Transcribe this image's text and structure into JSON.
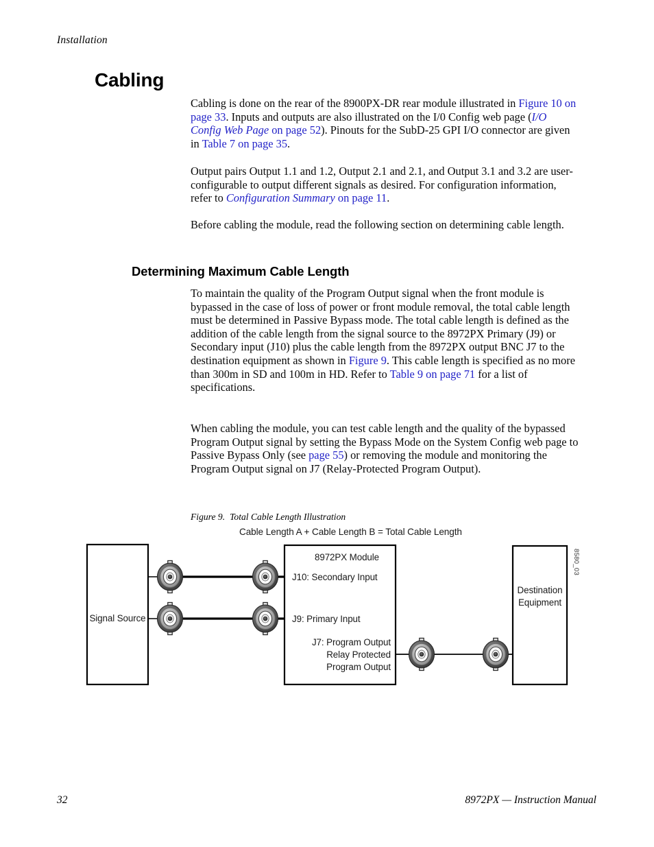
{
  "running_head": "Installation",
  "headings": {
    "h1": "Cabling",
    "h2": "Determining Maximum Cable Length"
  },
  "paragraphs": {
    "p1": {
      "seg1": "Cabling is done on the rear of the 8900PX-DR rear module illustrated in ",
      "link1": "Figure 10 on page 33",
      "seg2": ". Inputs and outputs are also illustrated on the I/0 Config web page (",
      "link2_italic": "I/O Config Web Page",
      "link2_rest": " on page 52",
      "seg3": "). Pinouts for the SubD-25 GPI I/O connector are given in ",
      "link3": "Table 7 on page 35",
      "seg4": "."
    },
    "p2": {
      "seg1": "Output pairs Output 1.1 and 1.2, Output 2.1 and 2.1, and Output 3.1 and 3.2 are user-configurable to output different signals as desired. For configuration information, refer to ",
      "link1_italic": "Configuration Summary",
      "link1_rest": " on page 11",
      "seg2": "."
    },
    "p3": {
      "seg1": "Before cabling the module, read the following section on determining cable length."
    },
    "p4": {
      "seg1": "To maintain the quality of the Program Output signal when the front module is bypassed in the case of loss of power or front module removal, the total cable length must be determined in Passive Bypass mode. The total cable length is defined as the addition of the cable length from the signal source to the 8972PX Primary (J9) or Secondary input (J10) plus the cable length from the 8972PX output BNC J7 to the destination equipment as shown in ",
      "link1": "Figure 9",
      "seg2": ". This cable length is specified as no more than 300m in SD and 100m in HD. Refer to ",
      "link2": "Table 9 on page 71",
      "seg3": " for a list of specifications."
    },
    "p5": {
      "seg1": "When cabling the module, you can test cable length and the quality of the bypassed Program Output signal by setting the Bypass Mode on the System Config web page to Passive Bypass Only (see ",
      "link1": "page 55",
      "seg2": ") or removing the module and monitoring the Program Output signal on J7 (Relay-Protected Program Output)."
    }
  },
  "figure": {
    "caption_number": "Figure 9.",
    "caption_title": "Total Cable Length Illustration",
    "subtitle": "Cable Length A + Cable Length B = Total Cable Length",
    "art_code": "8580_03",
    "boxes": {
      "signal_source": "Signal Source",
      "module_title": "8972PX Module",
      "destination_line1": "Destination",
      "destination_line2": "Equipment"
    },
    "port_labels": {
      "j10": "J10: Secondary Input",
      "j9": "J9: Primary Input",
      "j7_line1": "J7: Program Output",
      "j7_line2": "Relay Protected",
      "j7_line3": "Program Output"
    }
  },
  "footer": {
    "page_number": "32",
    "manual_title": "8972PX — Instruction Manual"
  },
  "colors": {
    "link": "#2222c8",
    "text": "#000000",
    "connector_outer": "#4d4d4d",
    "connector_ring": "#a8a8a8",
    "connector_inner": "#ffffff"
  }
}
